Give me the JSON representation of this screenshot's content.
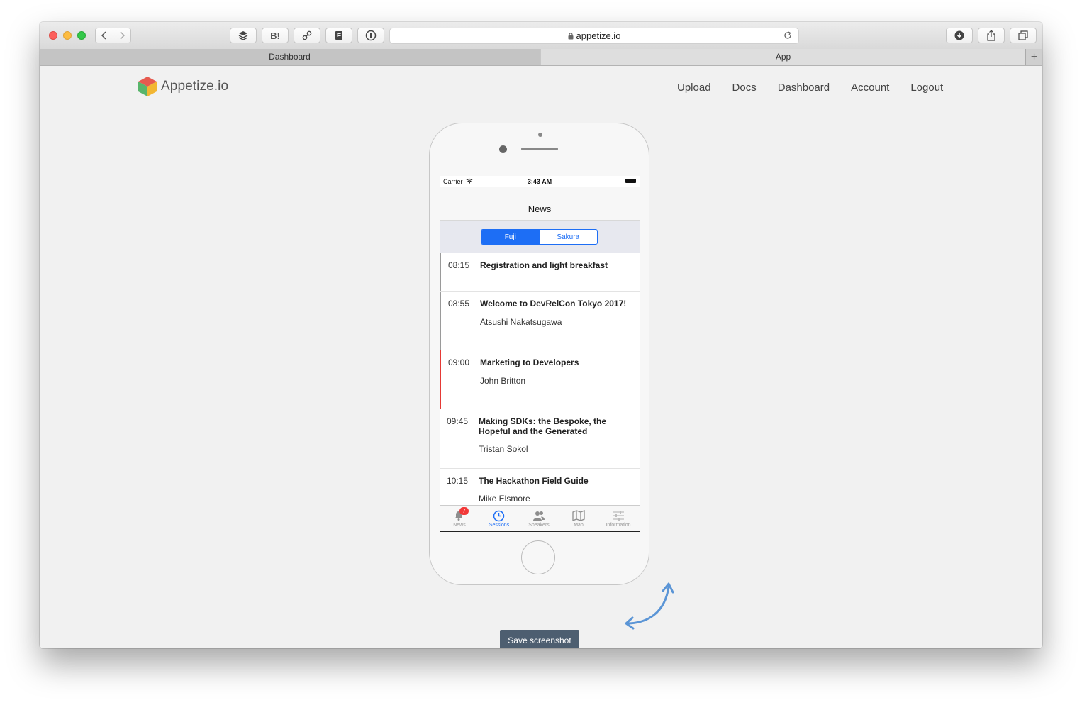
{
  "browser": {
    "url": "appetize.io",
    "tabs": [
      {
        "label": "Dashboard",
        "active": false
      },
      {
        "label": "App",
        "active": true
      }
    ],
    "toolbar_icons": [
      "back-icon",
      "forward-icon",
      "buffer-icon",
      "hatena-bookmark-icon",
      "link-icon",
      "pocket-stack-icon",
      "1password-icon",
      "download-icon",
      "share-icon",
      "tabs-overview-icon"
    ],
    "bookmark_label": "B!"
  },
  "site": {
    "logo_text": "Appetize.io",
    "nav": [
      "Upload",
      "Docs",
      "Dashboard",
      "Account",
      "Logout"
    ],
    "save_button": "Save screenshot"
  },
  "app": {
    "status": {
      "carrier": "Carrier",
      "time": "3:43 AM"
    },
    "nav_title": "News",
    "segments": [
      "Fuji",
      "Sakura"
    ],
    "selected_segment": "Fuji",
    "sessions": [
      {
        "time": "08:15",
        "title": "Registration and light breakfast",
        "speaker": "",
        "accent": "#9a9a9a"
      },
      {
        "time": "08:55",
        "title": "Welcome to DevRelCon Tokyo 2017!",
        "speaker": "Atsushi Nakatsugawa",
        "accent": "#9a9a9a"
      },
      {
        "time": "09:00",
        "title": "Marketing to Developers",
        "speaker": "John Britton",
        "accent": "#e53935"
      },
      {
        "time": "09:45",
        "title": "Making SDKs: the Bespoke, the Hopeful and the Generated",
        "speaker": "Tristan Sokol",
        "accent": ""
      },
      {
        "time": "10:15",
        "title": "The Hackathon Field Guide",
        "speaker": "Mike Elsmore",
        "accent": ""
      }
    ],
    "tabs": [
      {
        "label": "News",
        "icon": "bell-icon",
        "badge": "7"
      },
      {
        "label": "Sessions",
        "icon": "clock-icon",
        "active": true
      },
      {
        "label": "Speakers",
        "icon": "people-icon"
      },
      {
        "label": "Map",
        "icon": "map-icon"
      },
      {
        "label": "Information",
        "icon": "sliders-icon"
      }
    ]
  },
  "colors": {
    "accent_blue": "#1d6ef5",
    "save_button_bg": "#4d5e70",
    "badge_red": "#f23838"
  }
}
